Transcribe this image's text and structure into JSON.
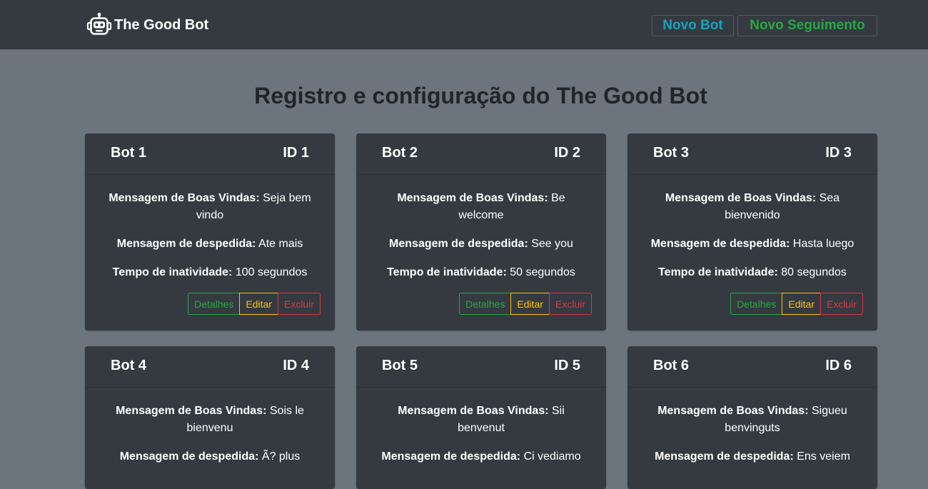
{
  "navbar": {
    "brand": "The Good Bot",
    "brand_icon": "robot-icon",
    "new_bot": "Novo Bot",
    "new_follow": "Novo Seguimento"
  },
  "page": {
    "title": "Registro e configuração do The Good Bot"
  },
  "labels": {
    "welcome": "Mensagem de Boas Vindas:",
    "farewell": "Mensagem de despedida:",
    "inactivity": "Tempo de inatividade:",
    "details": "Detalhes",
    "edit": "Editar",
    "delete": "Excluir"
  },
  "bots": [
    {
      "name": "Bot 1",
      "id": "ID 1",
      "welcome": "Seja bem vindo",
      "farewell": "Ate mais",
      "inactivity": "100 segundos"
    },
    {
      "name": "Bot 2",
      "id": "ID 2",
      "welcome": "Be welcome",
      "farewell": "See you",
      "inactivity": "50 segundos"
    },
    {
      "name": "Bot 3",
      "id": "ID 3",
      "welcome": "Sea bienvenido",
      "farewell": "Hasta luego",
      "inactivity": "80 segundos"
    },
    {
      "name": "Bot 4",
      "id": "ID 4",
      "welcome": "Sois le bienvenu",
      "farewell": "Ã? plus"
    },
    {
      "name": "Bot 5",
      "id": "ID 5",
      "welcome": "Sii benvenut",
      "farewell": "Ci vediamo"
    },
    {
      "name": "Bot 6",
      "id": "ID 6",
      "welcome": "Sigueu benvinguts",
      "farewell": "Ens veiem"
    }
  ],
  "colors": {
    "navbar": "#343a40",
    "page_bg": "#6c757d",
    "card_bg": "#343a40",
    "info": "#17a2b8",
    "success": "#28a745",
    "warning": "#ffc107",
    "danger": "#dc3545"
  }
}
